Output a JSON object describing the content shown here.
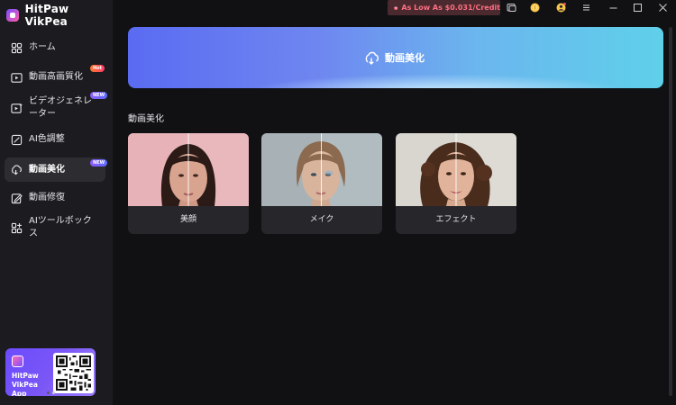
{
  "app": {
    "title": "HitPaw VikPea"
  },
  "titlebar": {
    "credit_text": "As Low As $0.031/Credit"
  },
  "sidebar": {
    "items": [
      {
        "label": "ホーム",
        "icon": "home-icon",
        "tag": ""
      },
      {
        "label": "動画高画質化",
        "icon": "video-enhance-icon",
        "tag": "Hot"
      },
      {
        "label": "ビデオジェネレーター",
        "icon": "video-generator-icon",
        "tag": "NEW"
      },
      {
        "label": "AI色調整",
        "icon": "color-adjust-icon",
        "tag": ""
      },
      {
        "label": "動画美化",
        "icon": "beautify-icon",
        "tag": "NEW"
      },
      {
        "label": "動画修復",
        "icon": "repair-icon",
        "tag": ""
      },
      {
        "label": "AIツールボックス",
        "icon": "toolbox-icon",
        "tag": ""
      }
    ],
    "active_index": 4,
    "promo": {
      "line1": "HitPaw",
      "line2": "VikPea App"
    }
  },
  "main": {
    "hero_label": "動画美化",
    "section_title": "動画美化",
    "cards": [
      {
        "label": "美顔"
      },
      {
        "label": "メイク"
      },
      {
        "label": "エフェクト"
      }
    ]
  },
  "colors": {
    "accent_hero_start": "#5a6bf2",
    "accent_hero_end": "#5fd0ea",
    "credit_text": "#ff6d82",
    "sidebar_bg": "#1c1c20",
    "main_bg": "#111114"
  }
}
